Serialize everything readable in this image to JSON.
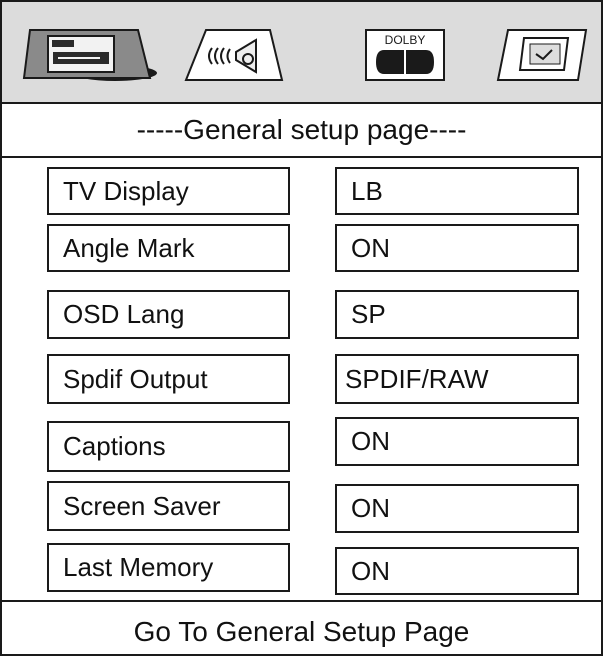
{
  "tabs": [
    {
      "icon": "general-setup-icon"
    },
    {
      "icon": "speaker-sound-icon"
    },
    {
      "icon": "dolby-audio-icon",
      "label": "DOLBY"
    },
    {
      "icon": "preference-tv-icon"
    }
  ],
  "page_title": "-----General setup page----",
  "settings": [
    {
      "name": "TV Display",
      "value": "LB"
    },
    {
      "name": "Angle Mark",
      "value": "ON"
    },
    {
      "name": "OSD Lang",
      "value": "SP"
    },
    {
      "name": "Spdif Output",
      "value": "SPDIF/RAW"
    },
    {
      "name": "Captions",
      "value": "ON"
    },
    {
      "name": "Screen Saver",
      "value": "ON"
    },
    {
      "name": "Last Memory",
      "value": "ON"
    }
  ],
  "footer": "Go To General Setup Page",
  "colors": {
    "tabbar_bg": "#dcdcdc",
    "line": "#1a1a1a",
    "selected_icon_fill": "#3a3a3a"
  }
}
